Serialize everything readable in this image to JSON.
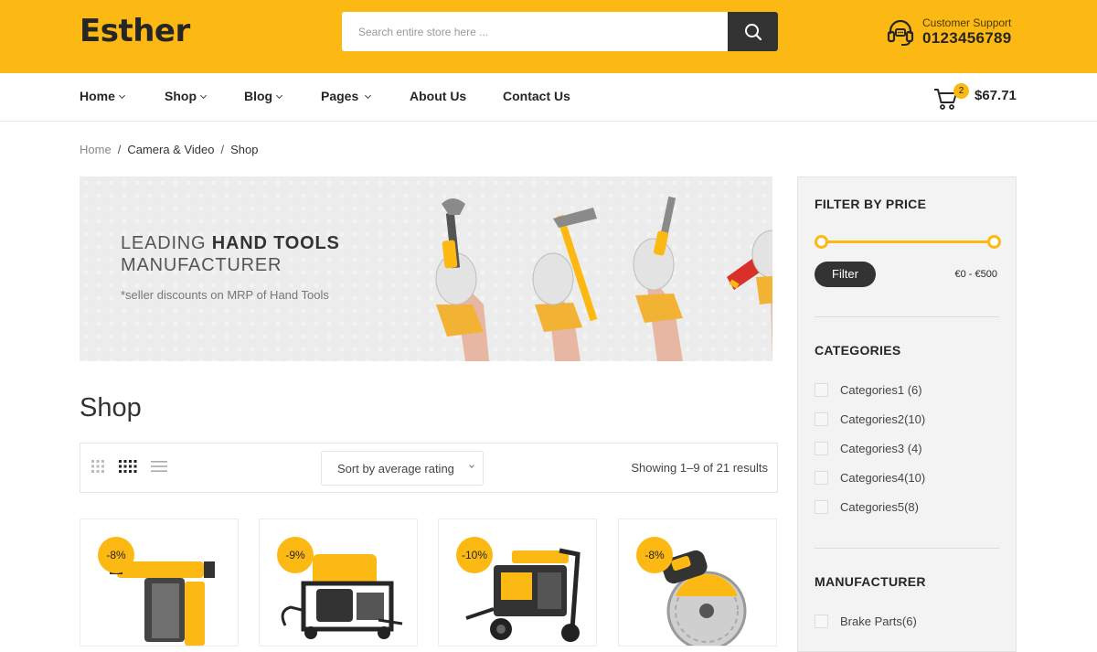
{
  "header": {
    "logo": "Esther",
    "search_placeholder": "Search entire store here ...",
    "support_label": "Customer Support",
    "support_phone": "0123456789",
    "accent_color": "#fdb913"
  },
  "nav": {
    "items": [
      {
        "label": "Home",
        "dropdown": true
      },
      {
        "label": "Shop",
        "dropdown": true
      },
      {
        "label": "Blog",
        "dropdown": true
      },
      {
        "label": "Pages",
        "dropdown": true
      },
      {
        "label": "About Us",
        "dropdown": false
      },
      {
        "label": "Contact Us",
        "dropdown": false
      }
    ],
    "cart_count": "2",
    "cart_total": "$67.71"
  },
  "breadcrumb": {
    "home": "Home",
    "section": "Camera & Video",
    "current": "Shop"
  },
  "banner": {
    "line1_light": "LEADING ",
    "line1_bold": "HAND TOOLS",
    "line2": "MANUFACTURER",
    "subtitle": "*seller discounts on MRP of Hand Tools"
  },
  "shop": {
    "title": "Shop",
    "sort_label": "Sort by average rating",
    "results_text": "Showing 1–9 of 21 results",
    "products": [
      {
        "discount": "-8%",
        "icon": "rotary-hammer-icon"
      },
      {
        "discount": "-9%",
        "icon": "generator-icon"
      },
      {
        "discount": "-10%",
        "icon": "pressure-washer-icon"
      },
      {
        "discount": "-8%",
        "icon": "circular-saw-icon"
      }
    ]
  },
  "sidebar": {
    "price_title": "FILTER BY PRICE",
    "filter_button": "Filter",
    "price_range": "€0 - €500",
    "categories_title": "CATEGORIES",
    "categories": [
      "Categories1 (6)",
      "Categories2(10)",
      "Categories3 (4)",
      "Categories4(10)",
      "Categories5(8)"
    ],
    "manufacturer_title": "MANUFACTURER",
    "manufacturers": [
      "Brake Parts(6)"
    ]
  }
}
